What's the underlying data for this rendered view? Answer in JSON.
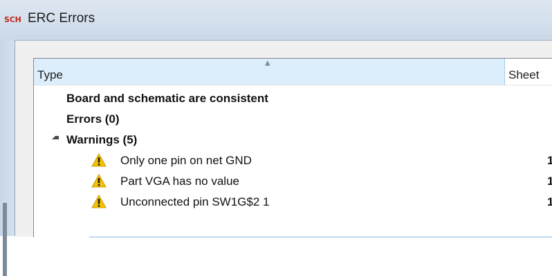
{
  "window": {
    "icon_text": "SCH",
    "title": "ERC Errors"
  },
  "list": {
    "columns": {
      "type": "Type",
      "sheet": "Sheet"
    },
    "summary": {
      "consistency": "Board and schematic are consistent",
      "errors": "Errors (0)",
      "warnings": "Warnings (5)"
    },
    "warnings": [
      {
        "message": "Only one pin on net GND",
        "sheet": "1"
      },
      {
        "message": "Part VGA has no value",
        "sheet": "1"
      },
      {
        "message": "Unconnected pin SW1G$2 1",
        "sheet": "1"
      }
    ]
  },
  "colors": {
    "titlebar": "#d3dfec",
    "header_selected": "#dceefc",
    "warning_fill": "#f5c400",
    "selection": "#7eb4ea",
    "icon_red": "#c0261d"
  },
  "icons": {
    "window": "sch-app-icon",
    "warning": "warning-triangle-icon",
    "expander": "expanded-triangle-icon",
    "sort": "sort-ascending-icon"
  }
}
